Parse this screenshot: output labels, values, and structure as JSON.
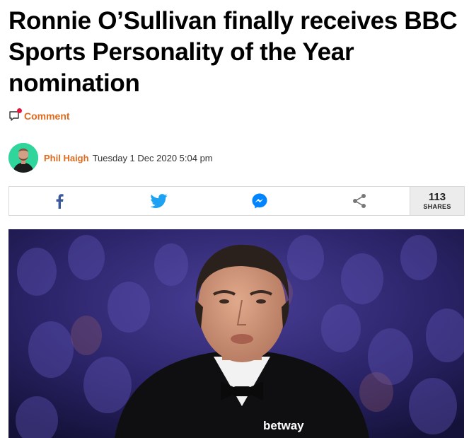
{
  "article": {
    "headline": "Ronnie O’Sullivan finally receives BBC Sports Personality of the Year nomination",
    "comment_label": "Comment",
    "author": "Phil Haigh",
    "date": "Tuesday 1 Dec 2020 5:04 pm"
  },
  "share_bar": {
    "buttons": [
      {
        "name": "facebook",
        "icon": "facebook-icon",
        "color": "#3b5998"
      },
      {
        "name": "twitter",
        "icon": "twitter-icon",
        "color": "#1da1f2"
      },
      {
        "name": "messenger",
        "icon": "messenger-icon",
        "color": "#0084ff"
      },
      {
        "name": "share",
        "icon": "share-icon",
        "color": "#777777"
      }
    ],
    "count": "113",
    "count_label": "SHARES"
  },
  "hero_image": {
    "sponsor_text": "betway"
  },
  "colors": {
    "accent": "#e06b1e",
    "notification": "#e5153b",
    "avatar_bg": "#2fd59a"
  }
}
